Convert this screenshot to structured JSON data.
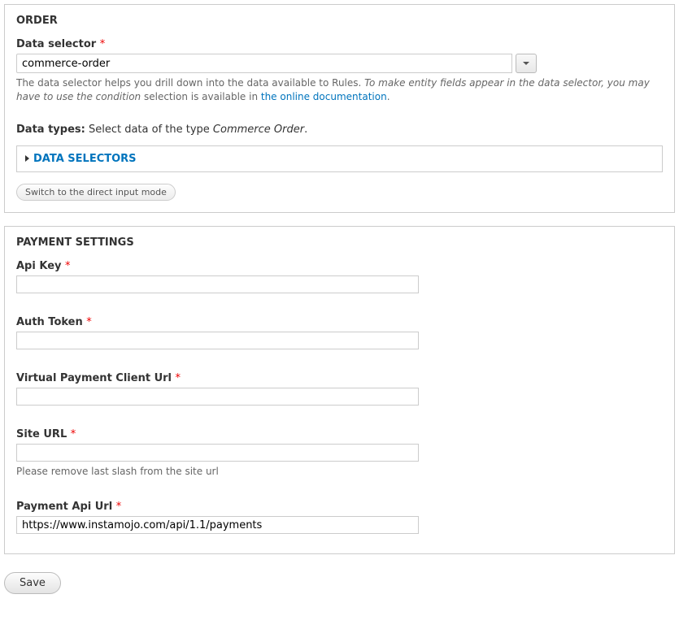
{
  "order_section": {
    "legend": "Order",
    "data_selector": {
      "label": "Data selector",
      "value": "commerce-order",
      "help_prefix": "The data selector helps you drill down into the data available to Rules. ",
      "help_italic": "To make entity fields appear in the data selector, you may have to use the condition",
      "help_suffix_prefix": " selection is available in ",
      "help_link_text": "the online documentation",
      "help_suffix": "."
    },
    "data_types": {
      "label": "Data types:",
      "text_prefix": " Select data of the type ",
      "text_italic": "Commerce Order",
      "text_suffix": "."
    },
    "data_selectors_title": "Data Selectors",
    "switch_button": "Switch to the direct input mode"
  },
  "payment_section": {
    "legend": "Payment Settings",
    "api_key": {
      "label": "Api Key",
      "value": ""
    },
    "auth_token": {
      "label": "Auth Token",
      "value": ""
    },
    "vpc_url": {
      "label": "Virtual Payment Client Url",
      "value": ""
    },
    "site_url": {
      "label": "Site URL",
      "value": "",
      "help": "Please remove last slash from the site url"
    },
    "payment_api_url": {
      "label": "Payment Api Url",
      "value": "https://www.instamojo.com/api/1.1/payments"
    }
  },
  "save_button": "Save"
}
